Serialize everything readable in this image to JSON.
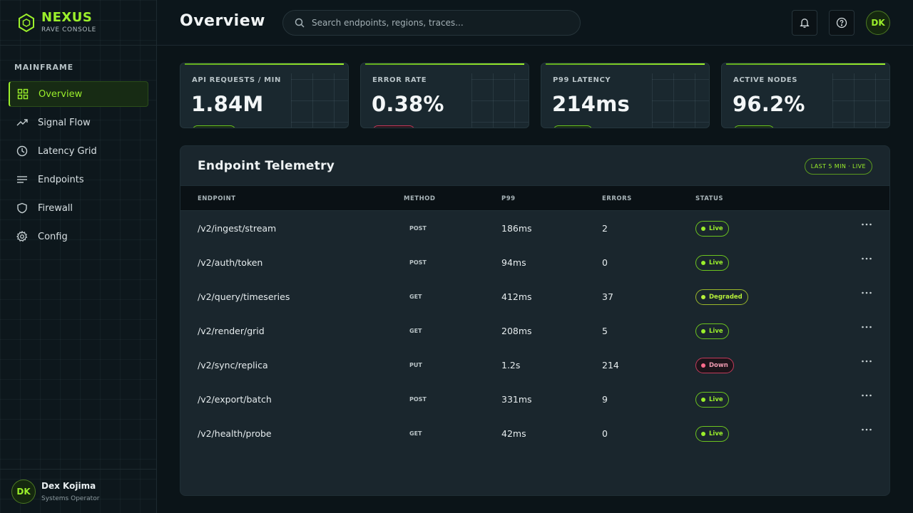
{
  "brand": {
    "name": "NEXUS",
    "subtitle": "RAVE CONSOLE"
  },
  "sidebar": {
    "section_label": "MAINFRAME",
    "items": [
      {
        "label": "Overview",
        "icon": "grid-icon",
        "active": true
      },
      {
        "label": "Signal Flow",
        "icon": "trend-icon"
      },
      {
        "label": "Latency Grid",
        "icon": "clock-icon"
      },
      {
        "label": "Endpoints",
        "icon": "list-icon"
      },
      {
        "label": "Firewall",
        "icon": "shield-icon"
      },
      {
        "label": "Config",
        "icon": "gear-icon"
      }
    ]
  },
  "user": {
    "initials": "DK",
    "name": "Dex Kojima",
    "role": "Systems Operator"
  },
  "header": {
    "title": "Overview",
    "search_placeholder": "Search endpoints, regions, traces...",
    "avatar_initials": "DK"
  },
  "kpis": [
    {
      "label": "API REQUESTS / MIN",
      "value": "1.84M",
      "trend": "good"
    },
    {
      "label": "ERROR RATE",
      "value": "0.38%",
      "trend": "bad"
    },
    {
      "label": "P99 LATENCY",
      "value": "214ms",
      "trend": "good"
    },
    {
      "label": "ACTIVE NODES",
      "value": "96.2%",
      "trend": "good"
    }
  ],
  "table": {
    "title": "Endpoint Telemetry",
    "badge": "LAST 5 MIN · LIVE",
    "columns": [
      "ENDPOINT",
      "METHOD",
      "P99",
      "ERRORS",
      "STATUS"
    ],
    "rows": [
      {
        "endpoint": "/v2/ingest/stream",
        "method": "POST",
        "p99": "186ms",
        "errors": "2",
        "status": "Live"
      },
      {
        "endpoint": "/v2/auth/token",
        "method": "POST",
        "p99": "94ms",
        "errors": "0",
        "status": "Live"
      },
      {
        "endpoint": "/v2/query/timeseries",
        "method": "GET",
        "p99": "412ms",
        "errors": "37",
        "status": "Degraded"
      },
      {
        "endpoint": "/v2/render/grid",
        "method": "GET",
        "p99": "208ms",
        "errors": "5",
        "status": "Live"
      },
      {
        "endpoint": "/v2/sync/replica",
        "method": "PUT",
        "p99": "1.2s",
        "errors": "214",
        "status": "Down"
      },
      {
        "endpoint": "/v2/export/batch",
        "method": "POST",
        "p99": "331ms",
        "errors": "9",
        "status": "Live"
      },
      {
        "endpoint": "/v2/health/probe",
        "method": "GET",
        "p99": "42ms",
        "errors": "0",
        "status": "Live"
      }
    ]
  },
  "colors": {
    "accent": "#9bef2b",
    "danger": "#c43a5a",
    "panel": "#1a262d"
  }
}
